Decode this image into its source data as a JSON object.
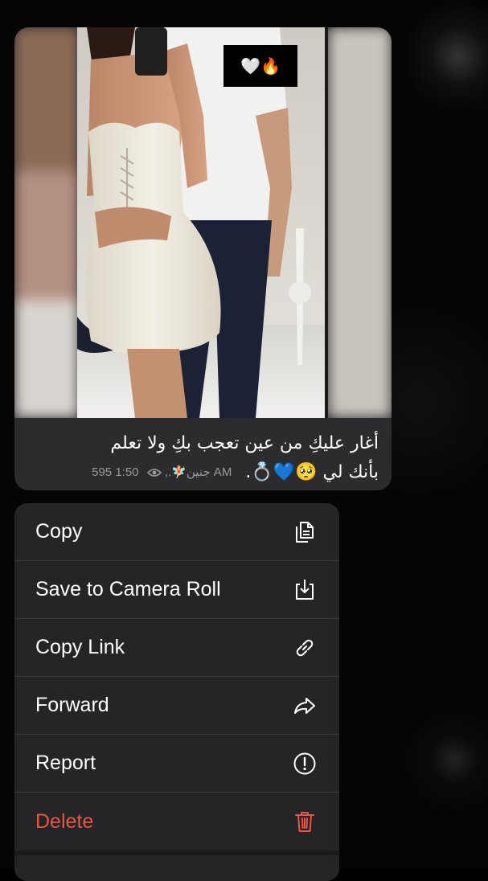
{
  "message": {
    "caption_line1": "أغار عليكِ من عين تعجب بكِ ولا تعلم",
    "caption_line2": "بأنك لي 🥺💙💍.",
    "views": "595",
    "author": "جنين🧚🏻.,",
    "time": "1:50 AM",
    "photo_sticker": "🤍🔥"
  },
  "menu": {
    "items": [
      {
        "label": "Copy",
        "icon": "copy-icon"
      },
      {
        "label": "Save to Camera Roll",
        "icon": "save-download-icon"
      },
      {
        "label": "Copy Link",
        "icon": "link-icon"
      },
      {
        "label": "Forward",
        "icon": "forward-icon"
      },
      {
        "label": "Report",
        "icon": "report-exclamation-icon"
      },
      {
        "label": "Delete",
        "icon": "trash-icon",
        "color": "#eb5545"
      }
    ]
  },
  "colors": {
    "menu_bg": "#252527",
    "bubble_bg": "#2c2c2e",
    "destructive": "#eb5545",
    "meta_text": "#9a9a9e"
  }
}
